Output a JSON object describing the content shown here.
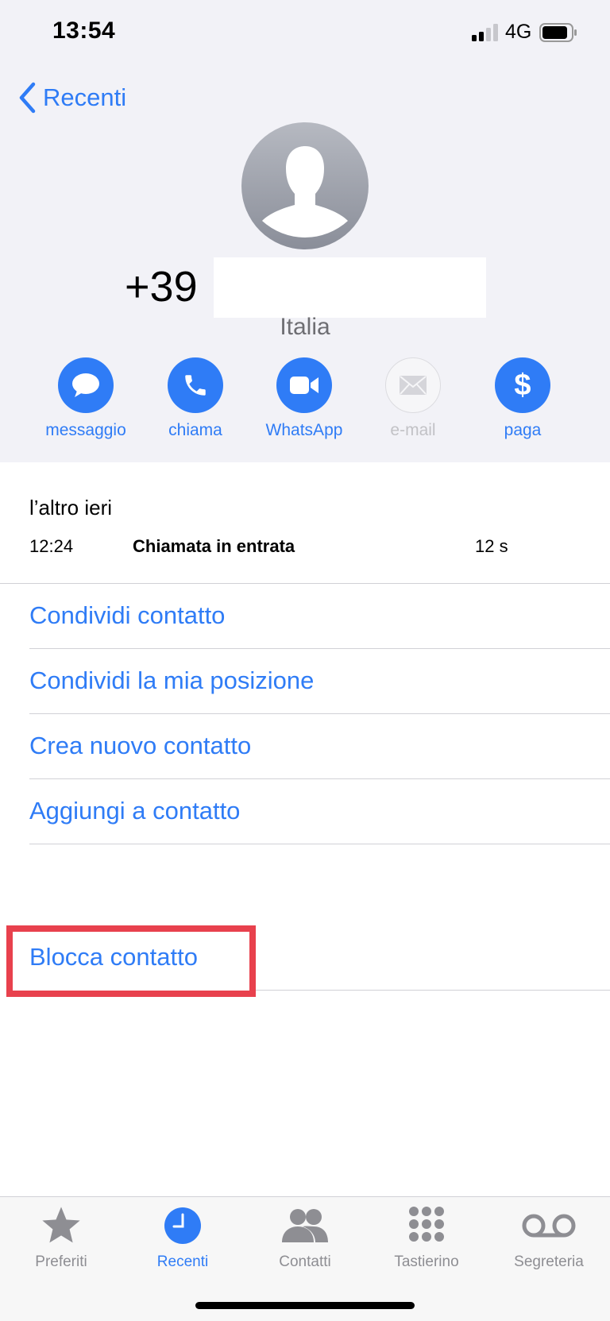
{
  "status_bar": {
    "time": "13:54",
    "network": "4G"
  },
  "nav": {
    "back_label": "Recenti"
  },
  "contact": {
    "number_prefix": "+39",
    "country": "Italia"
  },
  "actions": [
    {
      "label": "messaggio",
      "icon": "message-bubble-icon",
      "enabled": true
    },
    {
      "label": "chiama",
      "icon": "phone-icon",
      "enabled": true
    },
    {
      "label": "WhatsApp",
      "icon": "video-camera-icon",
      "enabled": true
    },
    {
      "label": "e-mail",
      "icon": "envelope-icon",
      "enabled": false
    },
    {
      "label": "paga",
      "icon": "dollar-icon",
      "enabled": true
    }
  ],
  "recent_call": {
    "date_label": "l’altro ieri",
    "time": "12:24",
    "type": "Chiamata in entrata",
    "duration": "12 s"
  },
  "options": {
    "share_contact": "Condividi contatto",
    "share_location": "Condividi la mia posizione",
    "create_contact": "Crea nuovo contatto",
    "add_to_contact": "Aggiungi a contatto",
    "block_contact": "Blocca contatto"
  },
  "tabs": [
    {
      "label": "Preferiti",
      "icon": "star-icon",
      "active": false
    },
    {
      "label": "Recenti",
      "icon": "clock-icon",
      "active": true
    },
    {
      "label": "Contatti",
      "icon": "contacts-icon",
      "active": false
    },
    {
      "label": "Tastierino",
      "icon": "keypad-icon",
      "active": false
    },
    {
      "label": "Segreteria",
      "icon": "voicemail-icon",
      "active": false
    }
  ],
  "colors": {
    "accent": "#2f7cf6",
    "highlight": "#e8414d",
    "disabled": "#c2c2c6"
  }
}
